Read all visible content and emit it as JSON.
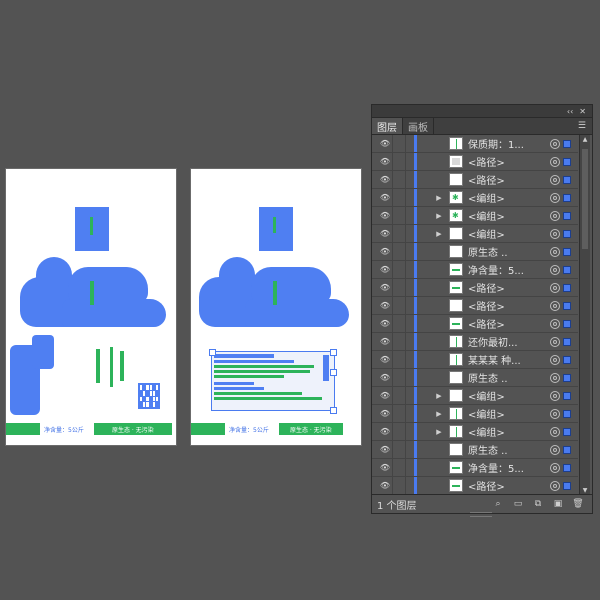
{
  "artboard1": {
    "bottom_bar": {
      "weight_text": "净含量：5公斤",
      "tag_text": "原生态 · 无污染"
    }
  },
  "artboard2": {
    "bottom_bar": {
      "weight_text": "净含量：5公斤",
      "tag_text": "原生态 · 无污染"
    }
  },
  "layers_panel": {
    "tabs": [
      {
        "label": "图层",
        "active": true
      },
      {
        "label": "画板",
        "active": false
      }
    ],
    "top_controls": {
      "collapse": "‹‹",
      "close": "✕"
    },
    "menu_icon": "menu-icon",
    "rows": [
      {
        "name": "保质期：1...",
        "thumb": "green-mark",
        "expandable": false
      },
      {
        "name": "<路径>",
        "thumb": "grey",
        "expandable": false
      },
      {
        "name": "<路径>",
        "thumb": "white",
        "expandable": false
      },
      {
        "name": "<编组>",
        "thumb": "green-char",
        "expandable": true
      },
      {
        "name": "<编组>",
        "thumb": "green-char",
        "expandable": true
      },
      {
        "name": "<编组>",
        "thumb": "white",
        "expandable": true
      },
      {
        "name": "原生态   ..",
        "thumb": "white",
        "expandable": false
      },
      {
        "name": "净含量：5...",
        "thumb": "green-line",
        "expandable": false
      },
      {
        "name": "<路径>",
        "thumb": "green-line",
        "expandable": false
      },
      {
        "name": "<路径>",
        "thumb": "white",
        "expandable": false
      },
      {
        "name": "<路径>",
        "thumb": "green-line",
        "expandable": false
      },
      {
        "name": "还你最初...",
        "thumb": "green-vert",
        "expandable": false
      },
      {
        "name": "某某某 种...",
        "thumb": "green-vert",
        "expandable": false
      },
      {
        "name": "原生态   ..",
        "thumb": "white",
        "expandable": false
      },
      {
        "name": "<编组>",
        "thumb": "white",
        "expandable": true
      },
      {
        "name": "<编组>",
        "thumb": "green-mark",
        "expandable": true
      },
      {
        "name": "<编组>",
        "thumb": "green-mark",
        "expandable": true
      },
      {
        "name": "原生态   ..",
        "thumb": "white",
        "expandable": false
      },
      {
        "name": "净含量：5...",
        "thumb": "green-line",
        "expandable": false
      },
      {
        "name": "<路径>",
        "thumb": "green-line",
        "expandable": false
      },
      {
        "name": "<路径>",
        "thumb": "white",
        "expandable": false
      }
    ],
    "footer": {
      "layer_count": "1 个图层",
      "icons": [
        "locate-object-icon",
        "make-clipping-mask-icon",
        "new-sublayer-icon",
        "new-layer-icon",
        "delete-layer-icon"
      ]
    }
  },
  "colors": {
    "background": "#535353",
    "selection_blue": "#4a7bf0",
    "accent_green": "#2db35a"
  }
}
